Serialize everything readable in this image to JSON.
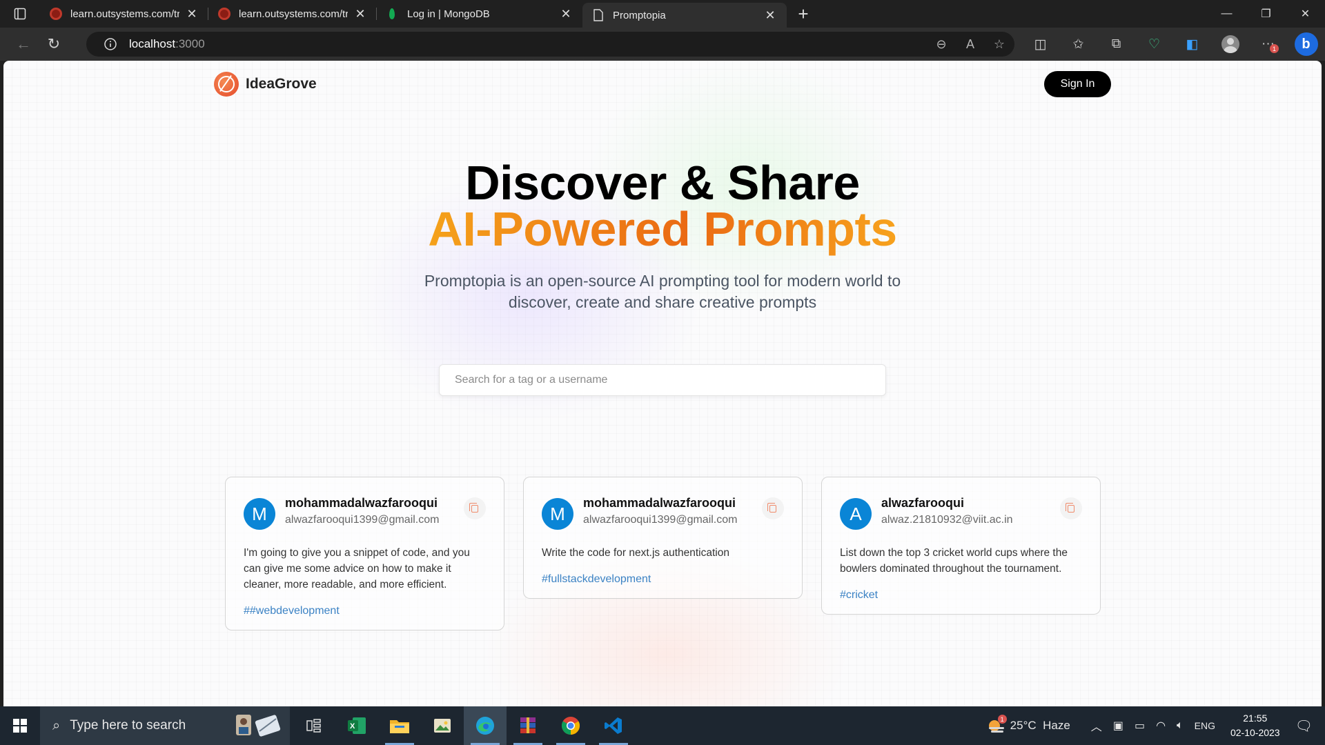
{
  "browser": {
    "tabs": [
      {
        "title": "learn.outsystems.com/training/jo",
        "favicon_color": "#c0392b",
        "active": false
      },
      {
        "title": "learn.outsystems.com/training/jo",
        "favicon_color": "#c0392b",
        "active": false
      },
      {
        "title": "Log in | MongoDB",
        "favicon_color": "#13aa52",
        "active": false
      },
      {
        "title": "Promptopia",
        "favicon_color": "#dddddd",
        "active": true
      }
    ],
    "address": {
      "host": "localhost",
      "port": ":3000"
    },
    "notification_badge": "1"
  },
  "site": {
    "logo_text": "IdeaGrove",
    "sign_in_label": "Sign In",
    "hero_line1": "Discover & Share",
    "hero_line2": "AI-Powered Prompts",
    "description": "Promptopia is an open-source AI prompting tool for modern world to discover, create and share creative prompts",
    "search_placeholder": "Search for a tag or a username",
    "accent_gradient": [
      "#f5a21b",
      "#ea6a13"
    ],
    "cards": [
      {
        "initial": "M",
        "username": "mohammadalwazfarooqui",
        "email": "alwazfarooqui1399@gmail.com",
        "prompt": "I'm going to give you a snippet of code, and you can give me some advice on how to make it cleaner, more readable, and more efficient.",
        "tag": "##webdevelopment"
      },
      {
        "initial": "M",
        "username": "mohammadalwazfarooqui",
        "email": "alwazfarooqui1399@gmail.com",
        "prompt": "Write the code for next.js authentication",
        "tag": "#fullstackdevelopment"
      },
      {
        "initial": "A",
        "username": "alwazfarooqui",
        "email": "alwaz.21810932@viit.ac.in",
        "prompt": "List down the top 3 cricket world cups where the bowlers dominated throughout the tournament.",
        "tag": "#cricket"
      }
    ]
  },
  "taskbar": {
    "search_text": "Type here to search",
    "weather": "25°C  Haze",
    "weather_badge": "1",
    "language": "ENG",
    "time": "21:55",
    "date": "02-10-2023"
  }
}
